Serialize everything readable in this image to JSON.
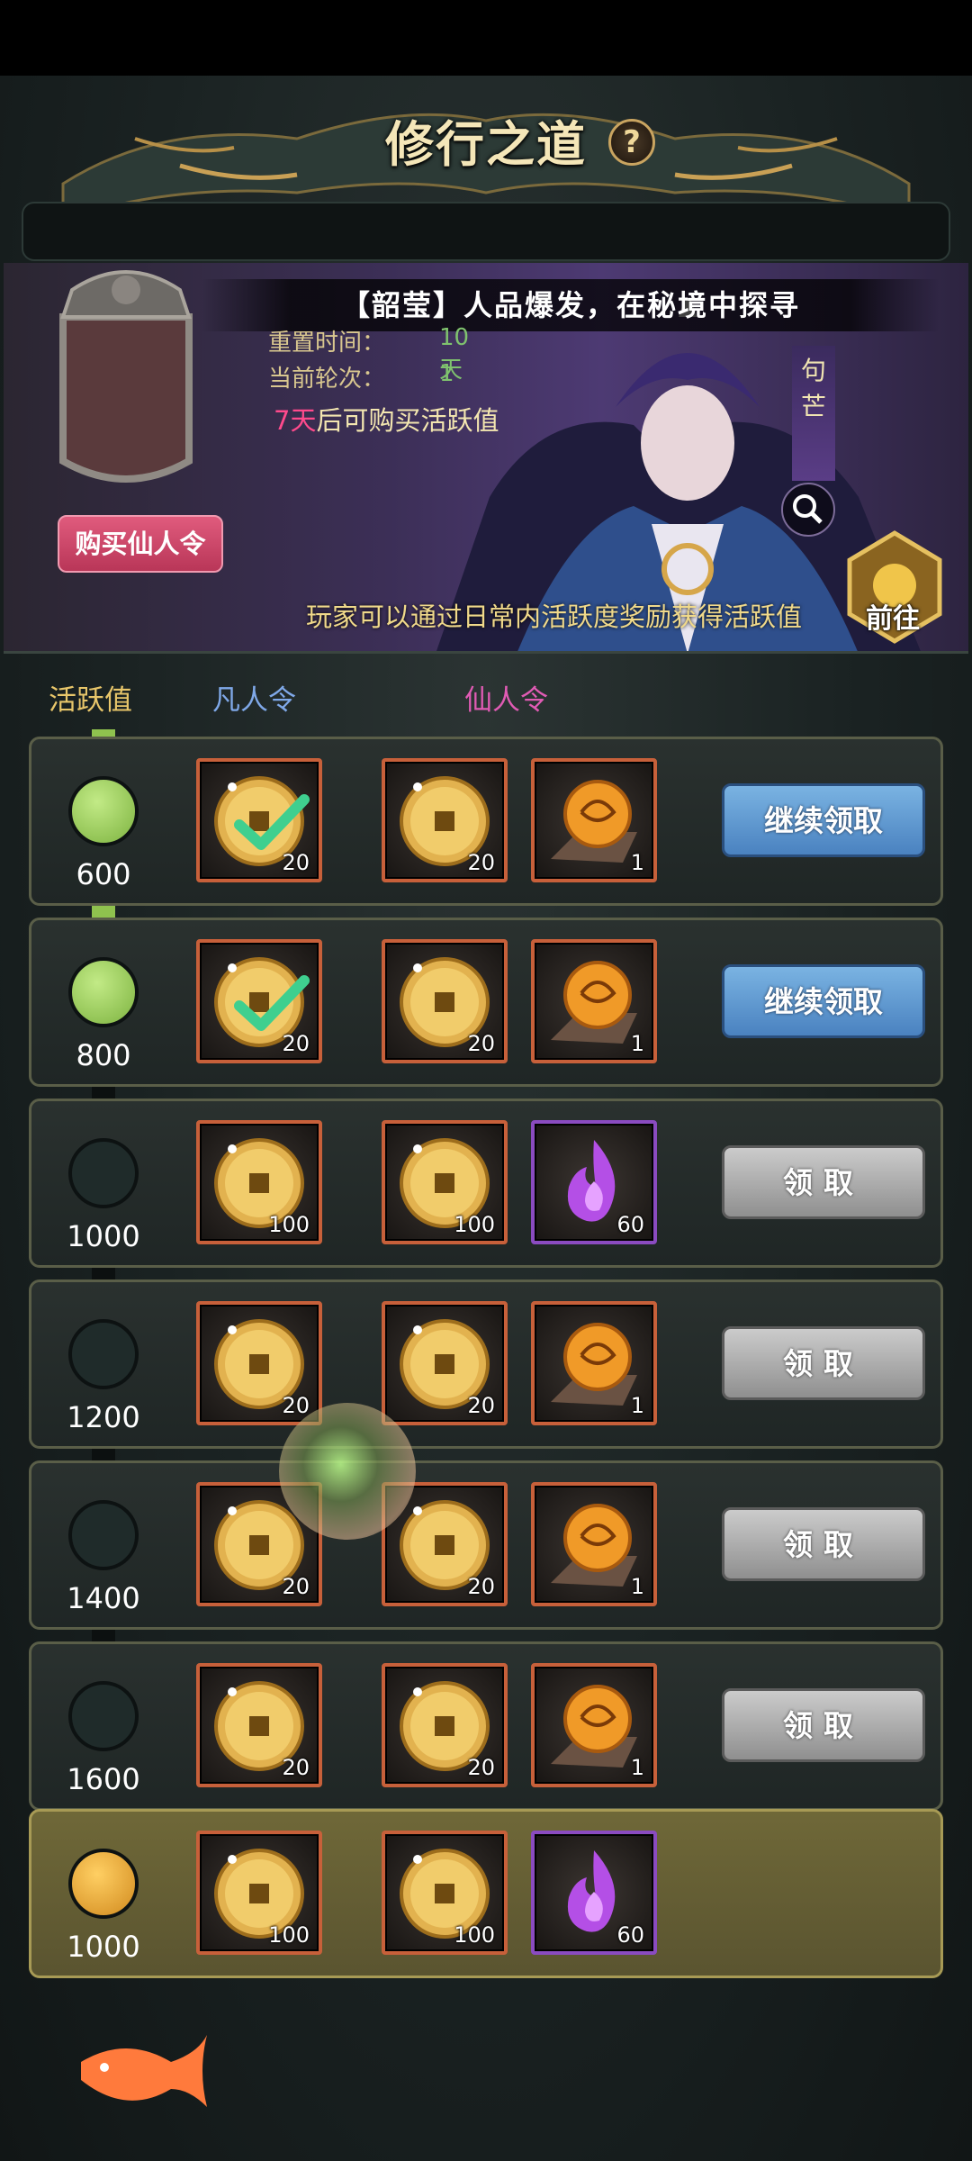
{
  "header": {
    "title": "修行之道",
    "help": "?"
  },
  "banner": {
    "marquee": "【韶莹】人品爆发，在秘境中探寻",
    "reset_label": "重置时间：",
    "reset_value": "10天",
    "round_label": "当前轮次：",
    "round_value": "1",
    "buy_hint_days": "7天",
    "buy_hint_text": "后可购买活跃值",
    "character_name": "句芒",
    "note": "玩家可以通过日常内活跃度奖励获得活跃值",
    "goto_label": "前往",
    "buy_button": "购买仙人令"
  },
  "columns": {
    "activity": "活跃值",
    "mortal": "凡人令",
    "immortal": "仙人令"
  },
  "colors": {
    "activity": "#e8c66a",
    "mortal": "#7fa8e8",
    "immortal": "#e05bb4",
    "track_fill": "#8fc24e"
  },
  "rows": [
    {
      "value": "600",
      "state": "on",
      "mortal": {
        "icon": "coin-icon",
        "count": "20",
        "claimed": true
      },
      "immortal": [
        {
          "icon": "coin-icon",
          "count": "20"
        },
        {
          "icon": "fire-orb-icon",
          "count": "1"
        }
      ],
      "button": "继续领取",
      "button_style": "blue"
    },
    {
      "value": "800",
      "state": "on",
      "mortal": {
        "icon": "coin-icon",
        "count": "20",
        "claimed": true
      },
      "immortal": [
        {
          "icon": "coin-icon",
          "count": "20"
        },
        {
          "icon": "fire-orb-icon",
          "count": "1"
        }
      ],
      "button": "继续领取",
      "button_style": "blue"
    },
    {
      "value": "1000",
      "state": "off",
      "mortal": {
        "icon": "coin-icon",
        "count": "100",
        "claimed": false
      },
      "immortal": [
        {
          "icon": "coin-icon",
          "count": "100"
        },
        {
          "icon": "purple-flame-icon",
          "count": "60"
        }
      ],
      "button": "领取",
      "button_style": "gray"
    },
    {
      "value": "1200",
      "state": "off",
      "mortal": {
        "icon": "coin-icon",
        "count": "20",
        "claimed": false
      },
      "immortal": [
        {
          "icon": "coin-icon",
          "count": "20"
        },
        {
          "icon": "fire-orb-icon",
          "count": "1"
        }
      ],
      "button": "领取",
      "button_style": "gray"
    },
    {
      "value": "1400",
      "state": "off",
      "mortal": {
        "icon": "coin-icon",
        "count": "20",
        "claimed": false
      },
      "immortal": [
        {
          "icon": "coin-icon",
          "count": "20"
        },
        {
          "icon": "fire-orb-icon",
          "count": "1"
        }
      ],
      "button": "领取",
      "button_style": "gray"
    },
    {
      "value": "1600",
      "state": "off",
      "mortal": {
        "icon": "coin-icon",
        "count": "20",
        "claimed": false
      },
      "immortal": [
        {
          "icon": "coin-icon",
          "count": "20"
        },
        {
          "icon": "fire-orb-icon",
          "count": "1"
        }
      ],
      "button": "领取",
      "button_style": "gray"
    },
    {
      "value": "1000",
      "state": "gold",
      "mortal": {
        "icon": "coin-icon",
        "count": "100",
        "claimed": false
      },
      "immortal": [
        {
          "icon": "coin-icon",
          "count": "100"
        },
        {
          "icon": "purple-flame-icon",
          "count": "60"
        }
      ],
      "button": "",
      "button_style": "none"
    }
  ]
}
